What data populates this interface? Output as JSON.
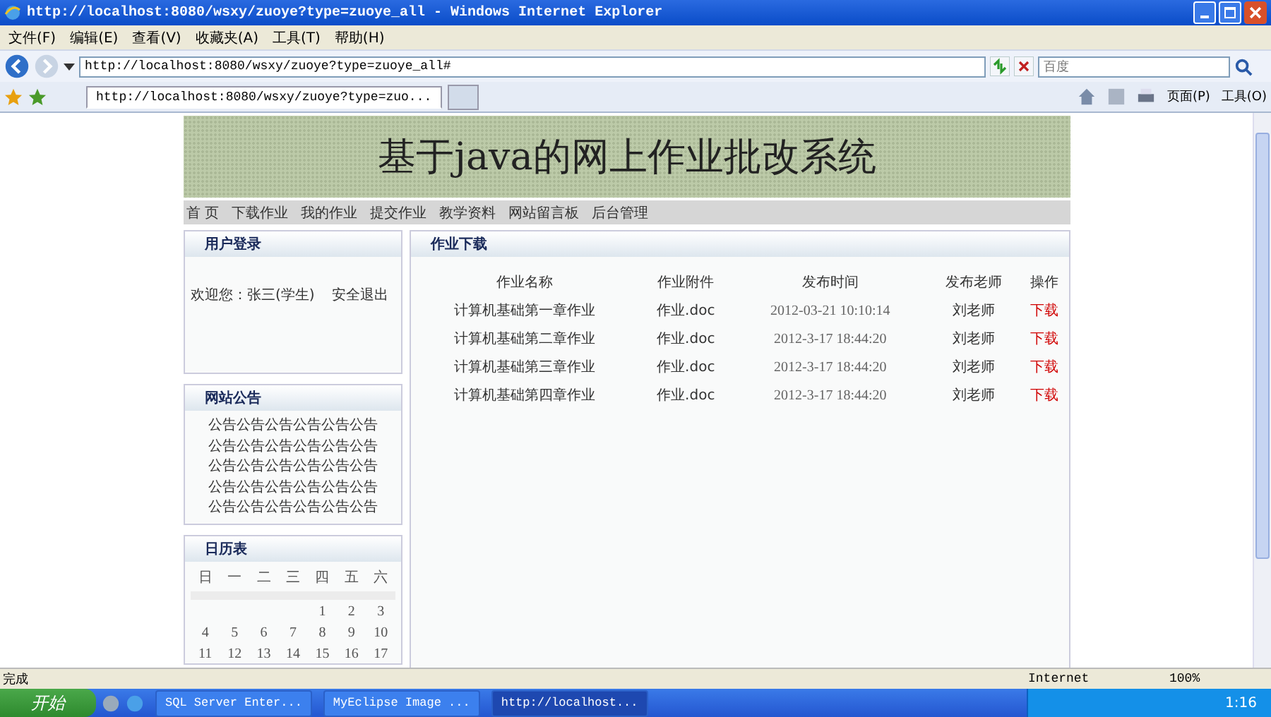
{
  "window": {
    "title": "http://localhost:8080/wsxy/zuoye?type=zuoye_all - Windows Internet Explorer"
  },
  "menu": [
    "文件(F)",
    "编辑(E)",
    "查看(V)",
    "收藏夹(A)",
    "工具(T)",
    "帮助(H)"
  ],
  "address": {
    "value": "http://localhost:8080/wsxy/zuoye?type=zuoye_all#"
  },
  "search": {
    "placeholder": "百度"
  },
  "tabs": [
    {
      "label": "http://localhost:8080/wsxy/zuoye?type=zuo...",
      "selected": true
    }
  ],
  "toolbar": [
    {
      "label": "页面(P)"
    },
    {
      "label": "工具(O)"
    }
  ],
  "page": {
    "banner": "基于java的网上作业批改系统",
    "nav": [
      "首 页",
      "下载作业",
      "我的作业",
      "提交作业",
      "教学资料",
      "网站留言板",
      "后台管理"
    ],
    "login": {
      "title": "用户登录",
      "welcome": "欢迎您：张三(学生)",
      "logout": "安全退出"
    },
    "notice": {
      "title": "网站公告",
      "items": [
        "公告公告公告公告公告公告",
        "公告公告公告公告公告公告",
        "公告公告公告公告公告公告",
        "公告公告公告公告公告公告",
        "公告公告公告公告公告公告"
      ]
    },
    "calendar": {
      "title": "日历表",
      "weekdays": [
        "日",
        "一",
        "二",
        "三",
        "四",
        "五",
        "六"
      ],
      "weeks": [
        [
          "1",
          "2",
          "3"
        ],
        [
          "4",
          "5",
          "6",
          "7",
          "8",
          "9",
          "10"
        ],
        [
          "11",
          "12",
          "13",
          "14",
          "15",
          "16",
          "17"
        ]
      ]
    },
    "downloads": {
      "title": "作业下载",
      "columns": [
        "作业名称",
        "作业附件",
        "发布时间",
        "发布老师",
        "操作"
      ],
      "rows": [
        {
          "name": "计算机基础第一章作业",
          "file": "作业.doc",
          "time": "2012-03-21 10:10:14",
          "teacher": "刘老师",
          "action": "下载"
        },
        {
          "name": "计算机基础第二章作业",
          "file": "作业.doc",
          "time": "2012-3-17 18:44:20",
          "teacher": "刘老师",
          "action": "下载"
        },
        {
          "name": "计算机基础第三章作业",
          "file": "作业.doc",
          "time": "2012-3-17 18:44:20",
          "teacher": "刘老师",
          "action": "下载"
        },
        {
          "name": "计算机基础第四章作业",
          "file": "作业.doc",
          "time": "2012-3-17 18:44:20",
          "teacher": "刘老师",
          "action": "下载"
        }
      ]
    }
  },
  "status_bar": {
    "text": "完成",
    "zone": "Internet",
    "zoom": "100%"
  },
  "taskbar": {
    "start": "开始",
    "tasks": [
      {
        "label": "SQL Server Enter...",
        "selected": false
      },
      {
        "label": "MyEclipse Image ...",
        "selected": false
      },
      {
        "label": "http://localhost...",
        "selected": true
      }
    ],
    "clock": "1:16"
  }
}
